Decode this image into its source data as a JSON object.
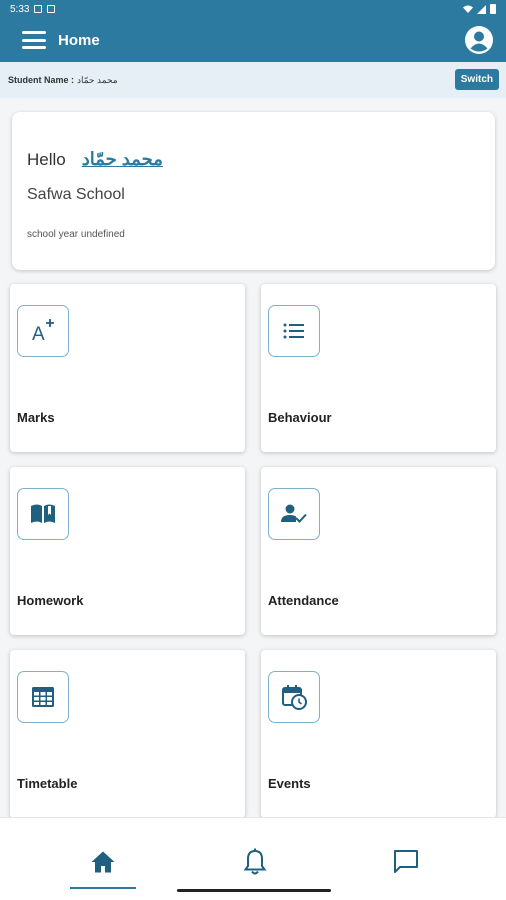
{
  "status_bar": {
    "time": "5:33"
  },
  "app_bar": {
    "title": "Home",
    "menu_icon": "menu-icon",
    "account_icon": "account-circle-icon"
  },
  "student": {
    "label": "Student Name :",
    "value": "محمد حمّاد",
    "switch_label": "Switch"
  },
  "greeting": {
    "hello": "Hello",
    "name": "محمد حمّاد",
    "school": "Safwa School",
    "school_year": "school year undefined"
  },
  "tiles": [
    {
      "label": "Marks",
      "icon": "grade-plus-icon"
    },
    {
      "label": "Behaviour",
      "icon": "list-icon"
    },
    {
      "label": "Homework",
      "icon": "book-icon"
    },
    {
      "label": "Attendance",
      "icon": "person-check-icon"
    },
    {
      "label": "Timetable",
      "icon": "table-icon"
    },
    {
      "label": "Events",
      "icon": "calendar-clock-icon"
    }
  ],
  "bottom_nav": {
    "items": [
      "home-icon",
      "bell-icon",
      "chat-icon"
    ],
    "active": "home-icon"
  },
  "colors": {
    "primary": "#2d7aa0",
    "icon": "#1f5f80",
    "student_bar": "#e6eff5",
    "background": "#f4f5f7"
  }
}
